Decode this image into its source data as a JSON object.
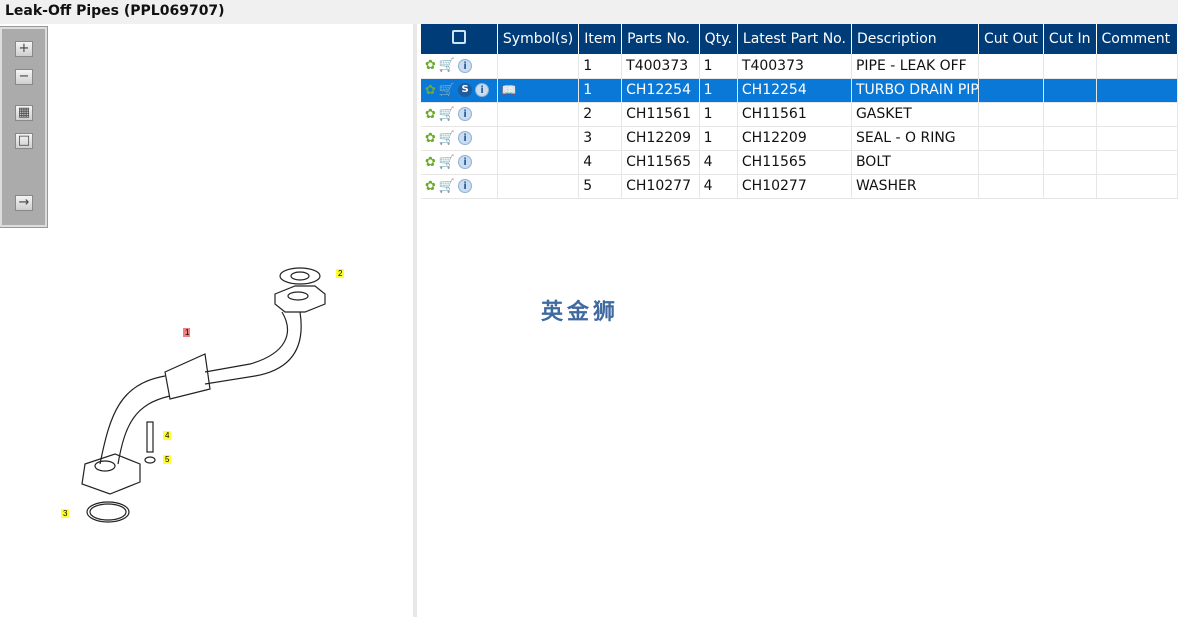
{
  "title": "Leak-Off Pipes (PPL069707)",
  "toolbar": {
    "zoom_in": "+",
    "zoom_out": "−",
    "fit": "▦",
    "actual": "□",
    "export": "→"
  },
  "headers": [
    "Symbol(s)",
    "Item",
    "Parts No.",
    "Qty.",
    "Latest Part No.",
    "Description",
    "Cut Out",
    "Cut In",
    "Comment"
  ],
  "rows": [
    {
      "item": "1",
      "part": "T400373",
      "qty": "1",
      "latest": "T400373",
      "desc": "PIPE - LEAK OFF",
      "selected": false
    },
    {
      "item": "1",
      "part": "CH12254",
      "qty": "1",
      "latest": "CH12254",
      "desc": "TURBO DRAIN PIP",
      "selected": true
    },
    {
      "item": "2",
      "part": "CH11561",
      "qty": "1",
      "latest": "CH11561",
      "desc": "GASKET",
      "selected": false
    },
    {
      "item": "3",
      "part": "CH12209",
      "qty": "1",
      "latest": "CH12209",
      "desc": "SEAL - O RING",
      "selected": false
    },
    {
      "item": "4",
      "part": "CH11565",
      "qty": "4",
      "latest": "CH11565",
      "desc": "BOLT",
      "selected": false
    },
    {
      "item": "5",
      "part": "CH10277",
      "qty": "4",
      "latest": "CH10277",
      "desc": "WASHER",
      "selected": false
    }
  ],
  "icons": {
    "gear": "✿",
    "cart": "🛒",
    "info": "i",
    "s": "S",
    "book": "📖"
  },
  "diagram_labels": [
    "1",
    "2",
    "3",
    "4",
    "5"
  ],
  "watermark": "英金狮"
}
